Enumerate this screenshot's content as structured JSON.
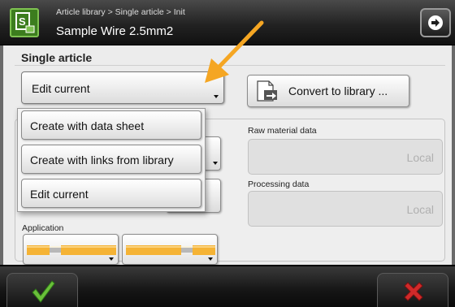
{
  "header": {
    "breadcrumb": "Article library > Single article > Init",
    "title": "Sample Wire 2.5mm2",
    "app_icon": "article-app-icon",
    "next_icon": "arrow-right-circle-icon"
  },
  "main": {
    "section_title": "Single article",
    "mode_select": {
      "selected": "Edit current",
      "options": [
        "Create with data sheet",
        "Create with links from library",
        "Edit current"
      ]
    },
    "convert_button": {
      "label": "Convert to library ...",
      "icon": "convert-document-icon"
    },
    "raw_material": {
      "label": "Raw material data",
      "value": "Local"
    },
    "processing": {
      "label": "Processing data",
      "value": "Local"
    },
    "application": {
      "label": "Application"
    }
  },
  "footer": {
    "ok_icon": "checkmark-icon",
    "cancel_icon": "cross-icon"
  },
  "colors": {
    "accent_orange": "#f5a623",
    "ok_green": "#6abf3a",
    "cancel_red": "#d02a2a",
    "app_icon_green": "#3c7d1e"
  }
}
